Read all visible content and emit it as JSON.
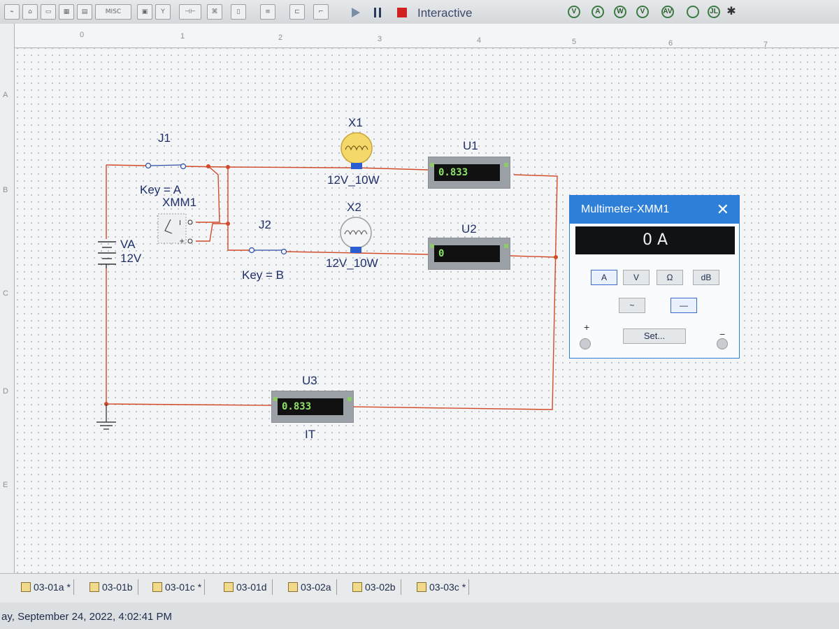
{
  "toolbar": {
    "misc_label": "MISC",
    "mode_label": "Interactive",
    "instruments": [
      "V",
      "A",
      "W",
      "V",
      "AV",
      "",
      "JL"
    ]
  },
  "ruler": {
    "columns": [
      "0",
      "1",
      "2",
      "3",
      "4",
      "5",
      "6",
      "7"
    ],
    "rows": [
      "A",
      "B",
      "C",
      "D",
      "E"
    ]
  },
  "schematic": {
    "switch_j1": {
      "name": "J1",
      "key": "Key = A"
    },
    "switch_j2": {
      "name": "J2",
      "key": "Key = B"
    },
    "multimeter_ref": "XMM1",
    "source": {
      "name": "VA",
      "value": "12V"
    },
    "lamp_x1": {
      "name": "X1",
      "rating": "12V_10W"
    },
    "lamp_x2": {
      "name": "X2",
      "rating": "12V_10W"
    },
    "ammeter_u1": {
      "name": "U1",
      "reading": "0.833"
    },
    "ammeter_u2": {
      "name": "U2",
      "reading": "0"
    },
    "ammeter_u3": {
      "name": "U3",
      "reading": "0.833",
      "label": "IT"
    }
  },
  "multimeter_window": {
    "title": "Multimeter-XMM1",
    "close": "✕",
    "display": "0 A",
    "modes": [
      "A",
      "V",
      "Ω",
      "dB"
    ],
    "waveforms": [
      "~",
      "—"
    ],
    "set_button": "Set...",
    "plus": "+",
    "minus": "−"
  },
  "tabs": [
    {
      "label": "03-01a",
      "modified": "*"
    },
    {
      "label": "03-01b",
      "modified": ""
    },
    {
      "label": "03-01c",
      "modified": "*"
    },
    {
      "label": "03-01d",
      "modified": ""
    },
    {
      "label": "03-02a",
      "modified": ""
    },
    {
      "label": "03-02b",
      "modified": ""
    },
    {
      "label": "03-03c",
      "modified": "*"
    }
  ],
  "status": "ay, September 24, 2022, 4:02:41 PM",
  "colors": {
    "wire": "#d14a2a",
    "accent": "#2e7fd8",
    "meter_text": "#8fe36a"
  }
}
